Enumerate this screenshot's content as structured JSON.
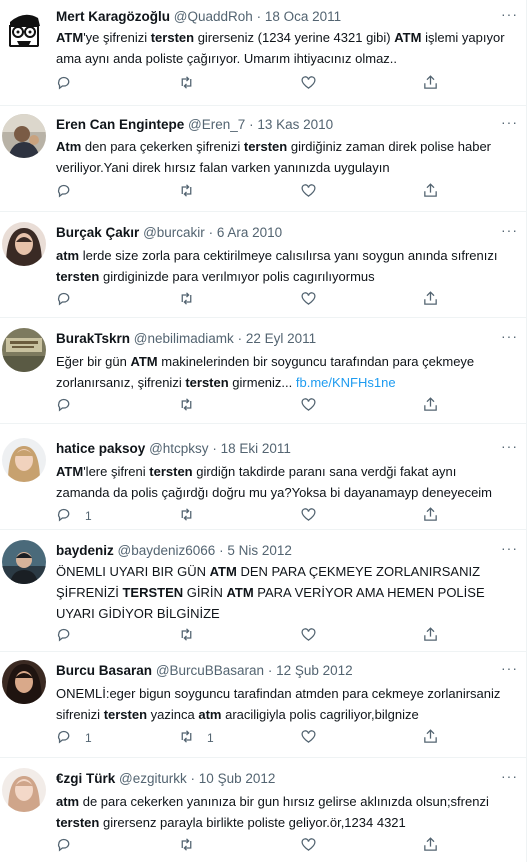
{
  "icons": {
    "reply": "reply-icon",
    "retweet": "retweet-icon",
    "like": "like-icon",
    "share": "share-icon",
    "more": "more-icon"
  },
  "colors": {
    "link": "#1d9bf0",
    "secondary": "#536471",
    "text": "#0f1419"
  },
  "more_label": "···",
  "tweets": [
    {
      "name": "Mert Karagözoğlu",
      "handle": "@QuaddRoh",
      "dot": "·",
      "date": "18 Oca 2011",
      "segments": [
        {
          "t": "ATM",
          "b": true
        },
        {
          "t": "'ye şifrenizi "
        },
        {
          "t": "tersten",
          "b": true
        },
        {
          "t": " girerseniz (1234 yerine 4321 gibi) "
        },
        {
          "t": "ATM",
          "b": true
        },
        {
          "t": " işlemi yapıyor ama aynı anda poliste çağırıyor. Umarım ihtiyacınız olmaz.."
        }
      ],
      "reply_count": "",
      "retweet_count": ""
    },
    {
      "name": "Eren Can Engintepe",
      "handle": "@Eren_7",
      "dot": "·",
      "date": "13 Kas 2010",
      "segments": [
        {
          "t": "Atm",
          "b": true
        },
        {
          "t": " den para çekerken şifrenizi "
        },
        {
          "t": "tersten",
          "b": true
        },
        {
          "t": " girdiğiniz zaman direk polise haber veriliyor.Yani direk hırsız falan varken yanınızda uygulayın"
        }
      ],
      "reply_count": "",
      "retweet_count": ""
    },
    {
      "name": "Burçak Çakır",
      "handle": "@burcakir",
      "dot": "·",
      "date": "6 Ara 2010",
      "segments": [
        {
          "t": "atm",
          "b": true
        },
        {
          "t": " lerde size zorla para cektirilmeye calısılırsa yanı soygun anında sıfrenızı "
        },
        {
          "t": "tersten",
          "b": true
        },
        {
          "t": " girdiginizde para verılmıyor polis cagırılıyormus"
        }
      ],
      "reply_count": "",
      "retweet_count": ""
    },
    {
      "name": "BurakTskrn",
      "handle": "@nebilimadiamk",
      "dot": "·",
      "date": "22 Eyl 2011",
      "segments": [
        {
          "t": "Eğer bir gün "
        },
        {
          "t": "ATM",
          "b": true
        },
        {
          "t": " makinelerinden bir soyguncu tarafından para çekmeye zorlanırsanız, şifrenizi "
        },
        {
          "t": "tersten",
          "b": true
        },
        {
          "t": " girmeniz... "
        },
        {
          "t": "fb.me/KNFHs1ne",
          "link": true
        }
      ],
      "reply_count": "",
      "retweet_count": ""
    },
    {
      "name": "hatice paksoy",
      "handle": "@htcpksy",
      "dot": "·",
      "date": "18 Eki 2011",
      "segments": [
        {
          "t": "ATM",
          "b": true
        },
        {
          "t": "'lere şifreni "
        },
        {
          "t": "tersten",
          "b": true
        },
        {
          "t": " girdiğn takdirde paranı sana verdği fakat aynı zamanda da polis çağırdğı doğru mu ya?Yoksa bi dayanamayp deneyeceim"
        }
      ],
      "reply_count": "1",
      "retweet_count": ""
    },
    {
      "name": "baydeniz",
      "handle": "@baydeniz6066",
      "dot": "·",
      "date": "5 Nis 2012",
      "segments": [
        {
          "t": "ÖNEMLI UYARI BIR GÜN "
        },
        {
          "t": "ATM",
          "b": true
        },
        {
          "t": " DEN PARA ÇEKMEYE ZORLANIRSANIZ ŞİFRENİZİ "
        },
        {
          "t": "TERSTEN",
          "b": true
        },
        {
          "t": " GİRİN "
        },
        {
          "t": "ATM",
          "b": true
        },
        {
          "t": " PARA VERİYOR AMA HEMEN POLİSE UYARI GİDİYOR BİLGİNİZE"
        }
      ],
      "reply_count": "",
      "retweet_count": ""
    },
    {
      "name": "Burcu Basaran",
      "handle": "@BurcuBBasaran",
      "dot": "·",
      "date": "12 Şub 2012",
      "segments": [
        {
          "t": "ONEMLİ:eger bigun soyguncu tarafindan atmden para cekmeye zorlanirsaniz sifrenizi "
        },
        {
          "t": "tersten",
          "b": true
        },
        {
          "t": " yazinca "
        },
        {
          "t": "atm",
          "b": true
        },
        {
          "t": " araciligiyla polis cagriliyor,bilgnize"
        }
      ],
      "reply_count": "1",
      "retweet_count": "1"
    },
    {
      "name": "€zgi Türk",
      "handle": "@ezgiturkk",
      "dot": "·",
      "date": "10 Şub 2012",
      "segments": [
        {
          "t": "atm",
          "b": true
        },
        {
          "t": " de para cekerken yanınıza bir gun hırsız gelirse aklınızda olsun;sfrenzi "
        },
        {
          "t": "tersten",
          "b": true
        },
        {
          "t": " girersenz parayla birlikte poliste geliyor.ör,1234 4321"
        }
      ],
      "reply_count": "",
      "retweet_count": ""
    }
  ]
}
